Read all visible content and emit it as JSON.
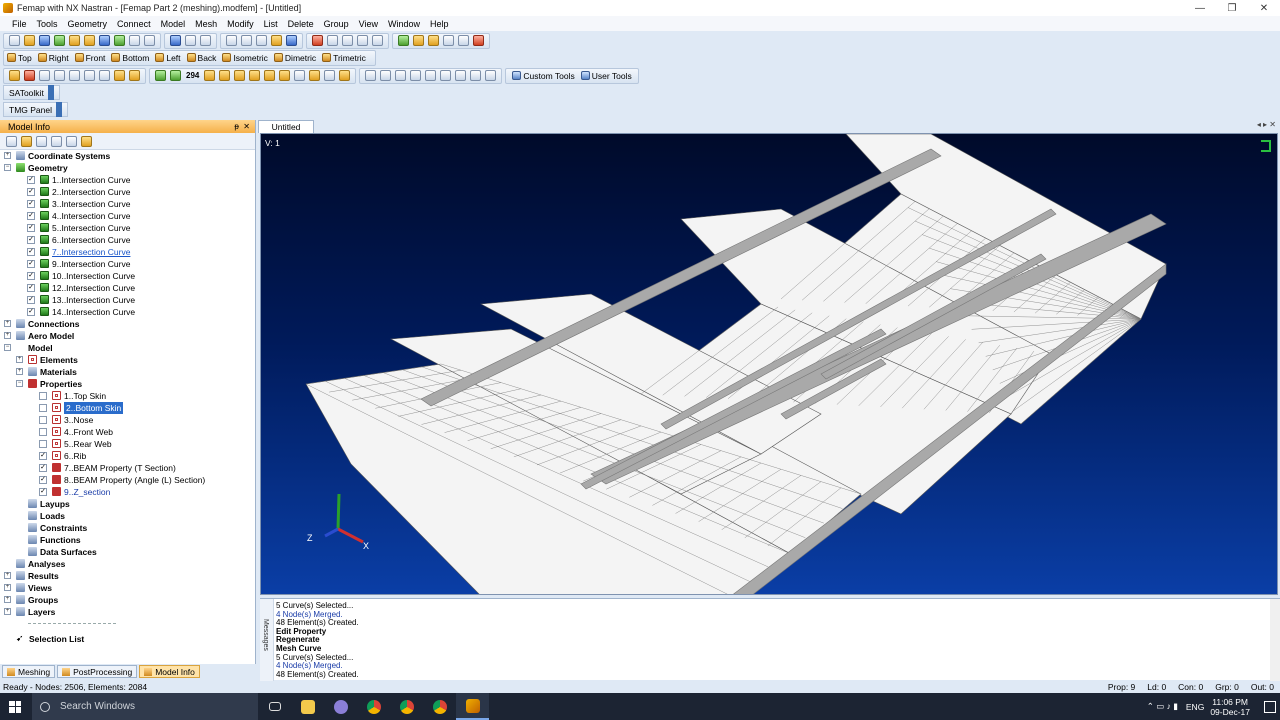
{
  "window": {
    "title": "Femap with NX Nastran - [Femap Part 2 (meshing).modfem] - [Untitled]",
    "min": "—",
    "max": "❐",
    "close": "✕"
  },
  "menu": [
    "File",
    "Tools",
    "Geometry",
    "Connect",
    "Model",
    "Mesh",
    "Modify",
    "List",
    "Delete",
    "Group",
    "View",
    "Window",
    "Help"
  ],
  "view_buttons": [
    "Top",
    "Right",
    "Front",
    "Bottom",
    "Left",
    "Back",
    "Isometric",
    "Dimetric",
    "Trimetric"
  ],
  "custom_tools": "Custom Tools",
  "user_tools": "User Tools",
  "toolbar_number": "294",
  "satoolkit": "SAToolkit",
  "tmg_panel": "TMG Panel",
  "panel": {
    "title": "Model Info",
    "pin": "ᵽ",
    "close": "✕",
    "tree": [
      {
        "label": "Coordinate Systems",
        "level": 0,
        "exp": "+",
        "bold": true,
        "icon": "axes"
      },
      {
        "label": "Geometry",
        "level": 0,
        "exp": "−",
        "bold": true,
        "icon": "geo"
      },
      {
        "label": "1..Intersection Curve",
        "level": 2,
        "cb": true,
        "icon": "curve"
      },
      {
        "label": "2..Intersection Curve",
        "level": 2,
        "cb": true,
        "icon": "curve"
      },
      {
        "label": "3..Intersection Curve",
        "level": 2,
        "cb": true,
        "icon": "curve"
      },
      {
        "label": "4..Intersection Curve",
        "level": 2,
        "cb": true,
        "icon": "curve"
      },
      {
        "label": "5..Intersection Curve",
        "level": 2,
        "cb": true,
        "icon": "curve"
      },
      {
        "label": "6..Intersection Curve",
        "level": 2,
        "cb": true,
        "icon": "curve"
      },
      {
        "label": "7..Intersection Curve",
        "level": 2,
        "cb": true,
        "icon": "curve",
        "link": true
      },
      {
        "label": "9..Intersection Curve",
        "level": 2,
        "cb": true,
        "icon": "curve"
      },
      {
        "label": "10..Intersection Curve",
        "level": 2,
        "cb": true,
        "icon": "curve"
      },
      {
        "label": "12..Intersection Curve",
        "level": 2,
        "cb": true,
        "icon": "curve"
      },
      {
        "label": "13..Intersection Curve",
        "level": 2,
        "cb": true,
        "icon": "curve"
      },
      {
        "label": "14..Intersection Curve",
        "level": 2,
        "cb": true,
        "icon": "curve"
      },
      {
        "label": "Connections",
        "level": 0,
        "exp": "+",
        "bold": true,
        "icon": "gen"
      },
      {
        "label": "Aero Model",
        "level": 0,
        "exp": "+",
        "bold": true,
        "icon": "gen"
      },
      {
        "label": "Model",
        "level": 0,
        "exp": "−",
        "bold": true,
        "icon": "none"
      },
      {
        "label": "Elements",
        "level": 1,
        "exp": "+",
        "bold": true,
        "icon": "prop"
      },
      {
        "label": "Materials",
        "level": 1,
        "exp": "+",
        "bold": true,
        "icon": "gen"
      },
      {
        "label": "Properties",
        "level": 1,
        "exp": "−",
        "bold": true,
        "icon": "red"
      },
      {
        "label": "1..Top Skin",
        "level": 3,
        "cb": false,
        "icon": "prop"
      },
      {
        "label": "2..Bottom Skin",
        "level": 3,
        "cb": false,
        "icon": "prop",
        "selected": true
      },
      {
        "label": "3..Nose",
        "level": 3,
        "cb": false,
        "icon": "prop"
      },
      {
        "label": "4..Front Web",
        "level": 3,
        "cb": false,
        "icon": "prop"
      },
      {
        "label": "5..Rear Web",
        "level": 3,
        "cb": false,
        "icon": "prop"
      },
      {
        "label": "6..Rib",
        "level": 3,
        "cb": true,
        "icon": "prop"
      },
      {
        "label": "7..BEAM Property (T Section)",
        "level": 3,
        "cb": true,
        "icon": "red"
      },
      {
        "label": "8..BEAM Property (Angle (L) Section)",
        "level": 3,
        "cb": true,
        "icon": "red"
      },
      {
        "label": "9..Z_section",
        "level": 3,
        "cb": true,
        "icon": "red",
        "blue": true
      },
      {
        "label": "Layups",
        "level": 1,
        "bold": true,
        "icon": "gen"
      },
      {
        "label": "Loads",
        "level": 1,
        "bold": true,
        "icon": "gen"
      },
      {
        "label": "Constraints",
        "level": 1,
        "bold": true,
        "icon": "gen"
      },
      {
        "label": "Functions",
        "level": 1,
        "bold": true,
        "icon": "gen"
      },
      {
        "label": "Data Surfaces",
        "level": 1,
        "bold": true,
        "icon": "gen"
      },
      {
        "label": "Analyses",
        "level": 0,
        "bold": true,
        "icon": "gen"
      },
      {
        "label": "Results",
        "level": 0,
        "exp": "+",
        "bold": true,
        "icon": "gen"
      },
      {
        "label": "Views",
        "level": 0,
        "exp": "+",
        "bold": true,
        "icon": "gen"
      },
      {
        "label": "Groups",
        "level": 0,
        "exp": "+",
        "bold": true,
        "icon": "gen"
      },
      {
        "label": "Layers",
        "level": 0,
        "exp": "+",
        "bold": true,
        "icon": "gen"
      }
    ],
    "selection_list": "Selection List"
  },
  "panel_tabs": [
    "Meshing",
    "PostProcessing",
    "Model Info"
  ],
  "view": {
    "tab": "Untitled",
    "label": "V: 1",
    "triad_x": "X",
    "triad_z": "Z"
  },
  "messages": {
    "side_label": "Messages",
    "lines": [
      {
        "text": "5 Curve(s) Selected...",
        "style": ""
      },
      {
        "text": "4 Node(s) Merged.",
        "style": "blue"
      },
      {
        "text": "48 Element(s) Created.",
        "style": ""
      },
      {
        "text": "Edit Property",
        "style": "b"
      },
      {
        "text": "Regenerate",
        "style": "b"
      },
      {
        "text": "Mesh Curve",
        "style": "b"
      },
      {
        "text": "5 Curve(s) Selected...",
        "style": ""
      },
      {
        "text": "4 Node(s) Merged.",
        "style": "blue"
      },
      {
        "text": "48 Element(s) Created.",
        "style": ""
      }
    ]
  },
  "status": {
    "left": "Ready - Nodes: 2506, Elements: 2084",
    "prop": "Prop: 9",
    "ld": "Ld: 0",
    "con": "Con: 0",
    "grp": "Grp: 0",
    "out": "Out: 0"
  },
  "taskbar": {
    "search": "Search Windows",
    "time": "11:06 PM",
    "date": "09-Dec-17",
    "lang": "ENG"
  }
}
